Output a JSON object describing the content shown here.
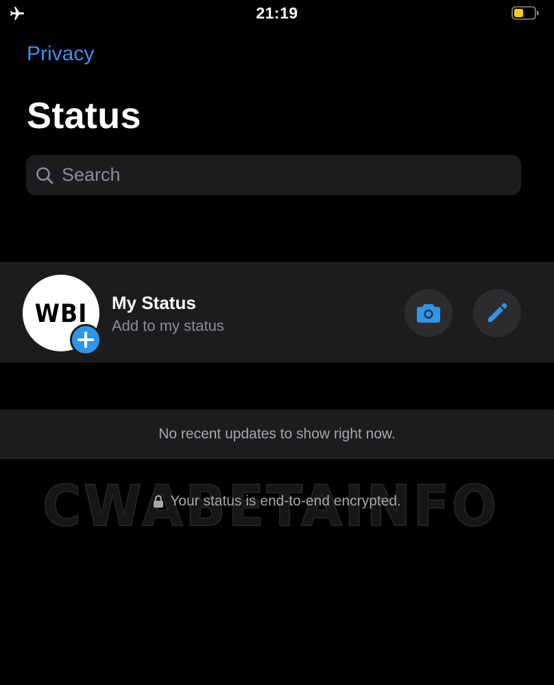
{
  "status_bar": {
    "time": "21:19",
    "airplane_icon": "airplane-icon",
    "battery_icon": "battery-low-icon",
    "battery_color": "#f5cc16"
  },
  "nav": {
    "back_label": "Privacy",
    "title": "Status"
  },
  "search": {
    "placeholder": "Search",
    "icon": "search-icon"
  },
  "my_status": {
    "avatar_text": "WBI",
    "name": "My Status",
    "subtitle": "Add to my status",
    "camera_icon": "camera-icon",
    "edit_icon": "pencil-icon",
    "add_badge_icon": "plus-icon"
  },
  "updates": {
    "empty_message": "No recent updates to show right now."
  },
  "footer": {
    "encryption_note": "Your status is end-to-end encrypted.",
    "lock_icon": "lock-icon"
  },
  "watermark": {
    "text": "CWABETAINFO"
  },
  "colors": {
    "accent": "#3d8ef0",
    "badge": "#2f95ea",
    "row_background": "#1c1c1e",
    "button_background": "#2c2c2e",
    "secondary_text": "#8e8e93"
  }
}
